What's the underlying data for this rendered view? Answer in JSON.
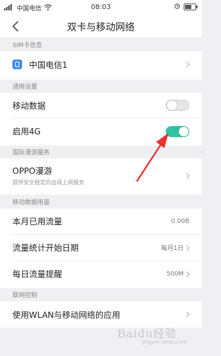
{
  "status_bar": {
    "left_text": "中国电信",
    "time": "08:03",
    "signal_icon": "signal-icon",
    "wifi_icon": "wifi-icon",
    "battery_icon": "battery-icon"
  },
  "header": {
    "title": "双卡与移动网络"
  },
  "sections": {
    "sim": "SIM卡信息",
    "general": "通用设置",
    "roaming": "国际漫游服务",
    "data_usage": "移动数据用量",
    "network_control": "联网控制"
  },
  "sim_row": {
    "label": "中国电信1"
  },
  "general": {
    "mobile_data_label": "移动数据",
    "mobile_data_on": false,
    "enable_4g_label": "启用4G",
    "enable_4g_on": true
  },
  "roaming": {
    "label": "OPPO漫游",
    "sub": "提供安全稳定的出境上网服务"
  },
  "data_usage": {
    "used_label": "本月已用流量",
    "used_value": "0.00B",
    "start_label": "流量统计开始日期",
    "start_value": "每月1日",
    "reminder_label": "每日流量提醒",
    "reminder_value": "500M"
  },
  "network_control": {
    "apps_label": "使用WLAN与移动网络的应用"
  },
  "colors": {
    "accent": "#33c2a6",
    "arrow": "#e8332e",
    "sim_icon": "#3c8cf2"
  },
  "watermark": {
    "text": "Baidu经验",
    "sub": "jingyan.baidu.com"
  }
}
